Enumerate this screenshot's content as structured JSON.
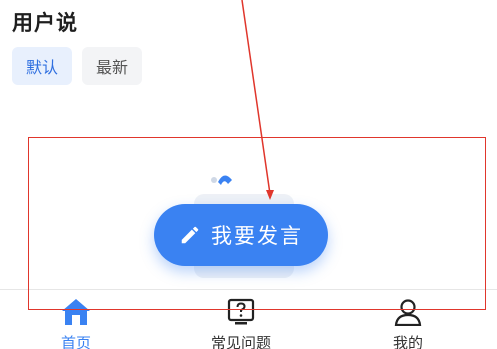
{
  "section": {
    "title": "用户说"
  },
  "tabs": [
    {
      "label": "默认",
      "active": true
    },
    {
      "label": "最新",
      "active": false
    }
  ],
  "fab": {
    "label": "我要发言",
    "icon": "pencil-icon"
  },
  "bottom_nav": [
    {
      "label": "首页",
      "icon": "home-icon",
      "active": true
    },
    {
      "label": "常见问题",
      "icon": "question-box-icon",
      "active": false
    },
    {
      "label": "我的",
      "icon": "user-icon",
      "active": false
    }
  ],
  "colors": {
    "accent": "#3a82f2",
    "tab_active_bg": "#e8f0fd",
    "annotation": "#e0362c"
  }
}
